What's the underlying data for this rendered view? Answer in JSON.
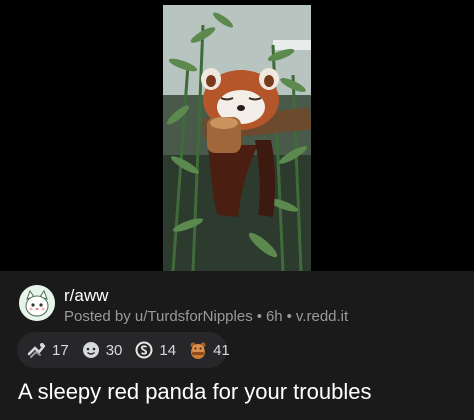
{
  "post": {
    "subreddit": "r/aww",
    "posted_by": "Posted by u/TurdsforNipples",
    "age": "6h",
    "domain": "v.redd.it",
    "separator": "•",
    "title": "A sleepy red panda for your troubles"
  },
  "awards": [
    {
      "icon": "helpful-award-icon",
      "count": "17"
    },
    {
      "icon": "wholesome-award-icon",
      "count": "30"
    },
    {
      "icon": "silver-award-icon",
      "count": "14"
    },
    {
      "icon": "hugz-award-icon",
      "count": "41"
    }
  ],
  "colors": {
    "background": "#000000",
    "panel": "#1a1a1b",
    "award_pill": "#272729",
    "meta_text": "#9a9a9c",
    "title_text": "#ffffff"
  }
}
